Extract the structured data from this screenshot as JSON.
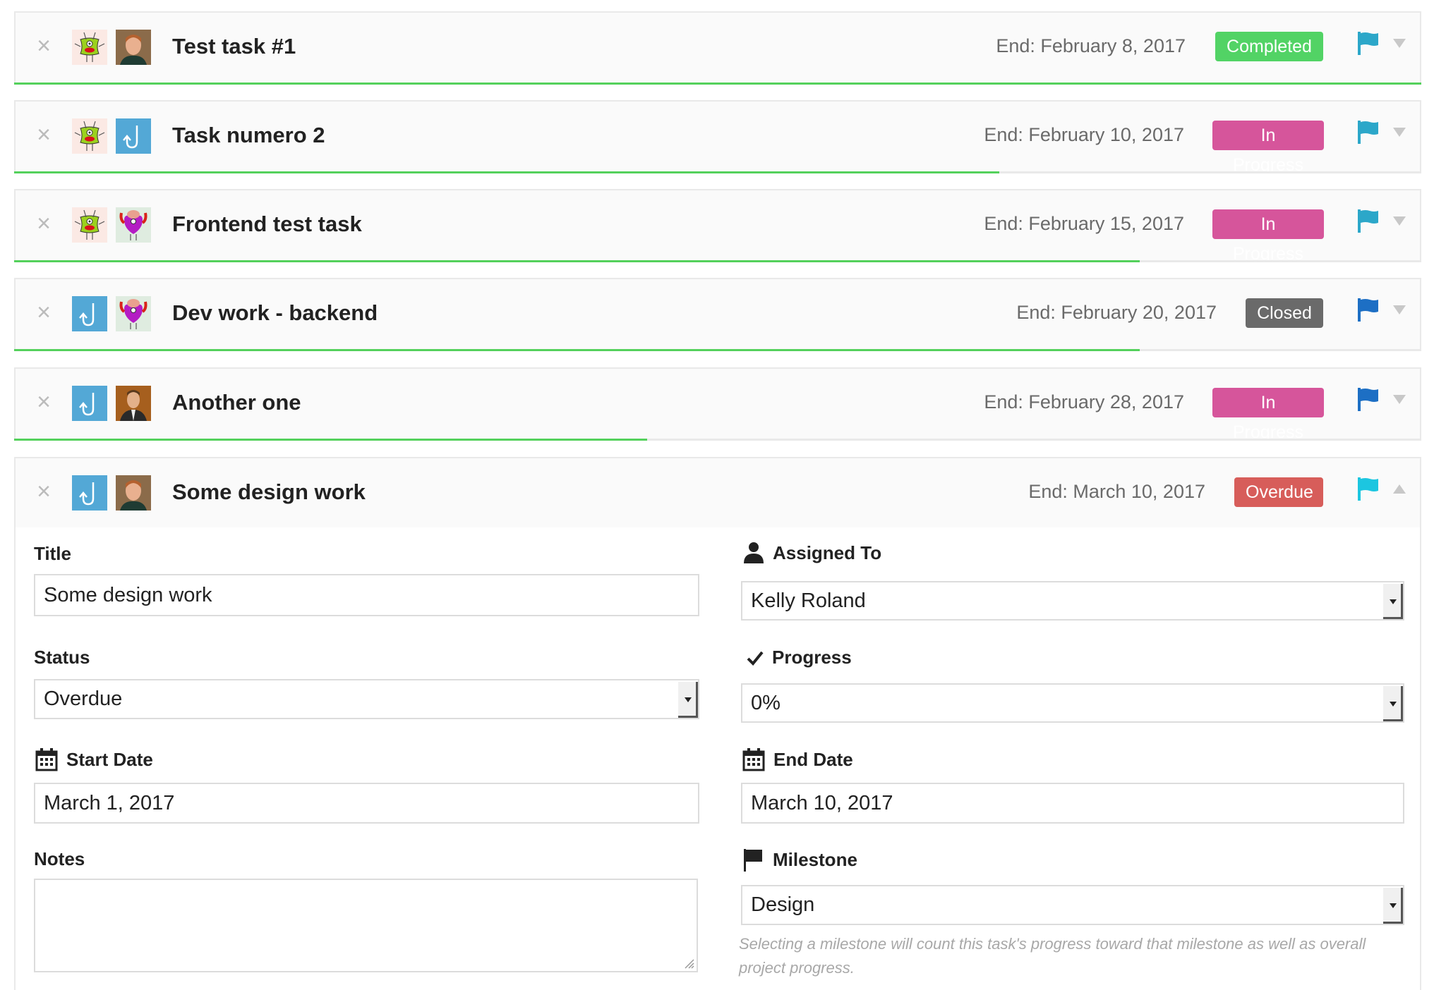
{
  "tasks": [
    {
      "title": "Test task #1",
      "end": "End: February 8, 2017",
      "status": "Completed",
      "status_color": "#52d365",
      "flag_color": "#2ca7c9",
      "progress": 1.0,
      "avatars": [
        "monster-green",
        "person-woman"
      ]
    },
    {
      "title": "Task numero 2",
      "end": "End: February 10, 2017",
      "status": "In Progress",
      "status_color": "#d6559b",
      "flag_color": "#2ca7c9",
      "progress": 0.7,
      "avatars": [
        "monster-green",
        "hook-logo"
      ]
    },
    {
      "title": "Frontend test task",
      "end": "End: February 15, 2017",
      "status": "In Progress",
      "status_color": "#d6559b",
      "flag_color": "#2ca7c9",
      "progress": 0.8,
      "avatars": [
        "monster-green",
        "monster-purple"
      ]
    },
    {
      "title": "Dev work - backend",
      "end": "End: February 20, 2017",
      "status": "Closed",
      "status_color": "#6a6a6a",
      "flag_color": "#1d6fc4",
      "progress": 0.8,
      "avatars": [
        "hook-logo",
        "monster-purple"
      ]
    },
    {
      "title": "Another one",
      "end": "End: February 28, 2017",
      "status": "In Progress",
      "status_color": "#d6559b",
      "flag_color": "#1d6fc4",
      "progress": 0.45,
      "avatars": [
        "hook-logo",
        "person-man"
      ]
    },
    {
      "title": "Some design work",
      "end": "End: March 10, 2017",
      "status": "Overdue",
      "status_color": "#d75d5a",
      "flag_color": "#1cc6e0",
      "progress": 0,
      "avatars": [
        "hook-logo",
        "person-woman"
      ],
      "expanded": true
    }
  ],
  "form": {
    "title_label": "Title",
    "title_value": "Some design work",
    "status_label": "Status",
    "status_value": "Overdue",
    "start_label": "Start Date",
    "start_value": "March 1, 2017",
    "notes_label": "Notes",
    "notes_value": "",
    "assigned_label": "Assigned To",
    "assigned_value": "Kelly Roland",
    "progress_label": "Progress",
    "progress_value": "0%",
    "end_label": "End Date",
    "end_value": "March 10, 2017",
    "milestone_label": "Milestone",
    "milestone_value": "Design",
    "milestone_help": "Selecting a milestone will count this task's progress toward that milestone as well as overall project progress."
  },
  "icons": {
    "close": "close-icon",
    "flag": "flag-icon",
    "caret_down": "chevron-down-icon",
    "caret_up": "chevron-up-icon",
    "user": "user-icon",
    "check": "check-icon",
    "calendar": "calendar-icon"
  }
}
